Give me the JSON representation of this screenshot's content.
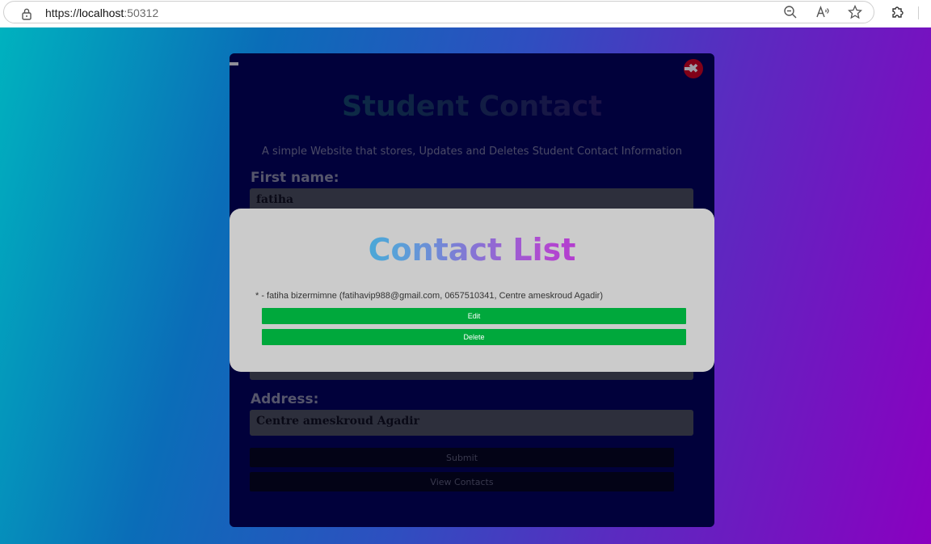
{
  "browser": {
    "url_scheme": "https://",
    "url_host": "localhost",
    "url_port": ":50312"
  },
  "form": {
    "title": "Student Contact",
    "subtitle": "A simple Website that stores, Updates and Deletes Student Contact Information",
    "first_name_label": "First name:",
    "first_name_value": "fatiha",
    "address_label": "Address:",
    "address_value": "Centre ameskroud Agadir",
    "submit_label": "Submit",
    "view_contacts_label": "View Contacts",
    "close_symbol": "✖"
  },
  "contact_list": {
    "title": "Contact List",
    "entries": [
      {
        "text": "* - fatiha bizermimne (fatihavip988@gmail.com, 0657510341, Centre ameskroud Agadir)",
        "edit_label": "Edit",
        "delete_label": "Delete"
      }
    ]
  },
  "colors": {
    "card_bg": "#030353",
    "modal_bg": "#cbcbcb",
    "action_green": "#00a83c",
    "close_red": "#d0021b"
  }
}
